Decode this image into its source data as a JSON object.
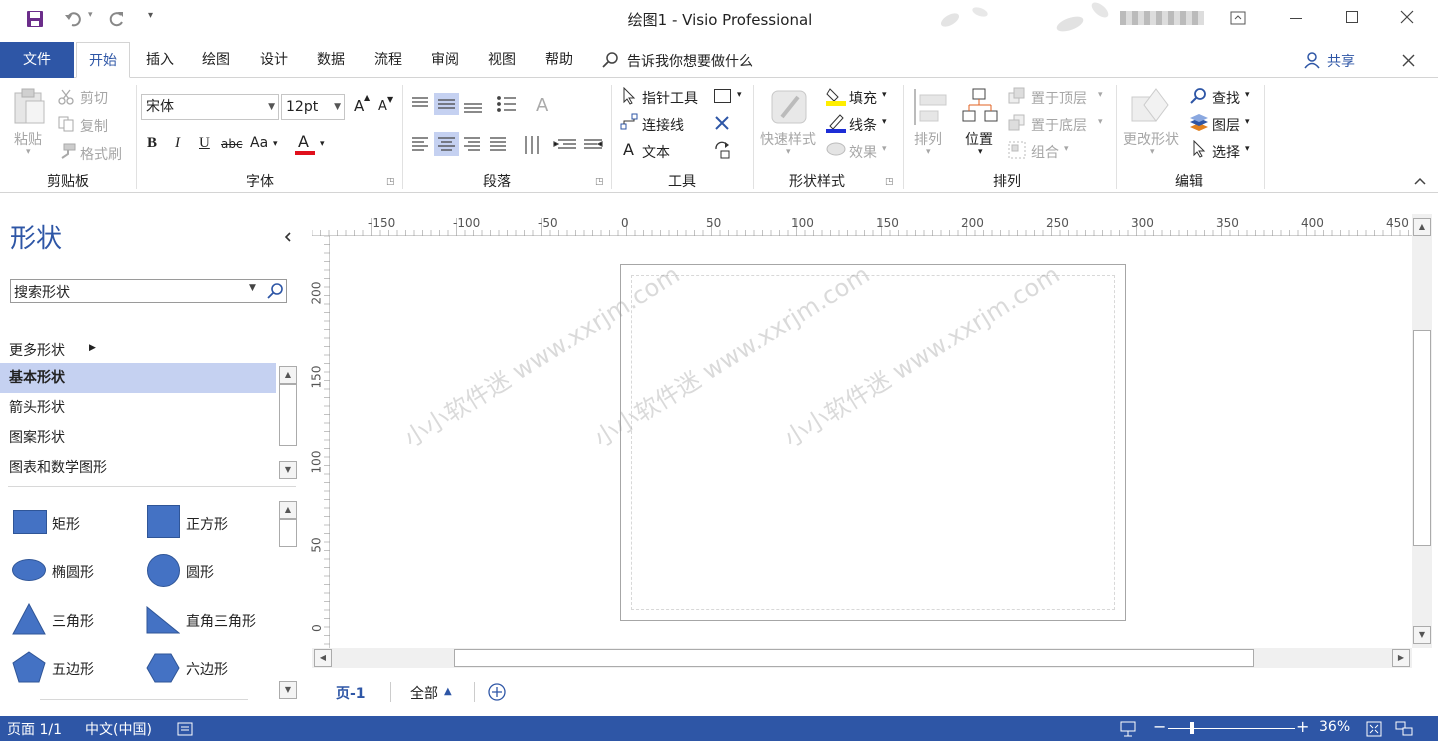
{
  "titlebar": {
    "title": "绘图1  -  Visio Professional"
  },
  "tabs": [
    {
      "label": "文件"
    },
    {
      "label": "开始"
    },
    {
      "label": "插入"
    },
    {
      "label": "绘图"
    },
    {
      "label": "设计"
    },
    {
      "label": "数据"
    },
    {
      "label": "流程"
    },
    {
      "label": "审阅"
    },
    {
      "label": "视图"
    },
    {
      "label": "帮助"
    }
  ],
  "tell_me": "告诉我你想要做什么",
  "share": "共享",
  "ribbon": {
    "clipboard": {
      "paste": "粘贴",
      "cut": "剪切",
      "copy": "复制",
      "format_painter": "格式刷",
      "label": "剪贴板"
    },
    "font": {
      "name": "宋体",
      "size": "12pt",
      "label": "字体",
      "bold": "B",
      "italic": "I",
      "underline": "U",
      "strike": "abc",
      "case": "Aa",
      "color": "A",
      "grow": "A",
      "shrink": "A"
    },
    "paragraph": {
      "label": "段落"
    },
    "tools": {
      "pointer": "指针工具",
      "connector": "连接线",
      "text": "文本",
      "label": "工具",
      "text_glyph": "A"
    },
    "shape_styles": {
      "quick_styles": "快速样式",
      "fill": "填充",
      "line": "线条",
      "effects": "效果",
      "label": "形状样式"
    },
    "arrange": {
      "align": "排列",
      "position": "位置",
      "bring_front": "置于顶层",
      "send_back": "置于底层",
      "group": "组合",
      "label": "排列"
    },
    "editing": {
      "change_shape": "更改形状",
      "find": "查找",
      "layers": "图层",
      "select": "选择",
      "label": "编辑"
    }
  },
  "shapes_pane": {
    "title": "形状",
    "search_placeholder": "搜索形状",
    "more_shapes": "更多形状",
    "stencils": [
      {
        "label": "基本形状"
      },
      {
        "label": "箭头形状"
      },
      {
        "label": "图案形状"
      },
      {
        "label": "图表和数学图形"
      }
    ],
    "shapes": [
      {
        "label": "矩形"
      },
      {
        "label": "正方形"
      },
      {
        "label": "椭圆形"
      },
      {
        "label": "圆形"
      },
      {
        "label": "三角形"
      },
      {
        "label": "直角三角形"
      },
      {
        "label": "五边形"
      },
      {
        "label": "六边形"
      }
    ]
  },
  "ruler": {
    "h_ticks": [
      "-150",
      "-100",
      "-50",
      "0",
      "50",
      "100",
      "150",
      "200",
      "250",
      "300",
      "350",
      "400",
      "450"
    ],
    "v_ticks": [
      "200",
      "150",
      "100",
      "50",
      "0"
    ]
  },
  "watermark": "小小软件迷 www.xxrjm.com",
  "page_tabs": {
    "page": "页-1",
    "all": "全部"
  },
  "status": {
    "page": "页面 1/1",
    "language": "中文(中国)",
    "zoom": "36%",
    "zoom_level": 0.36
  },
  "colors": {
    "accent": "#2e56a6",
    "shape_fill": "#4472c4"
  }
}
